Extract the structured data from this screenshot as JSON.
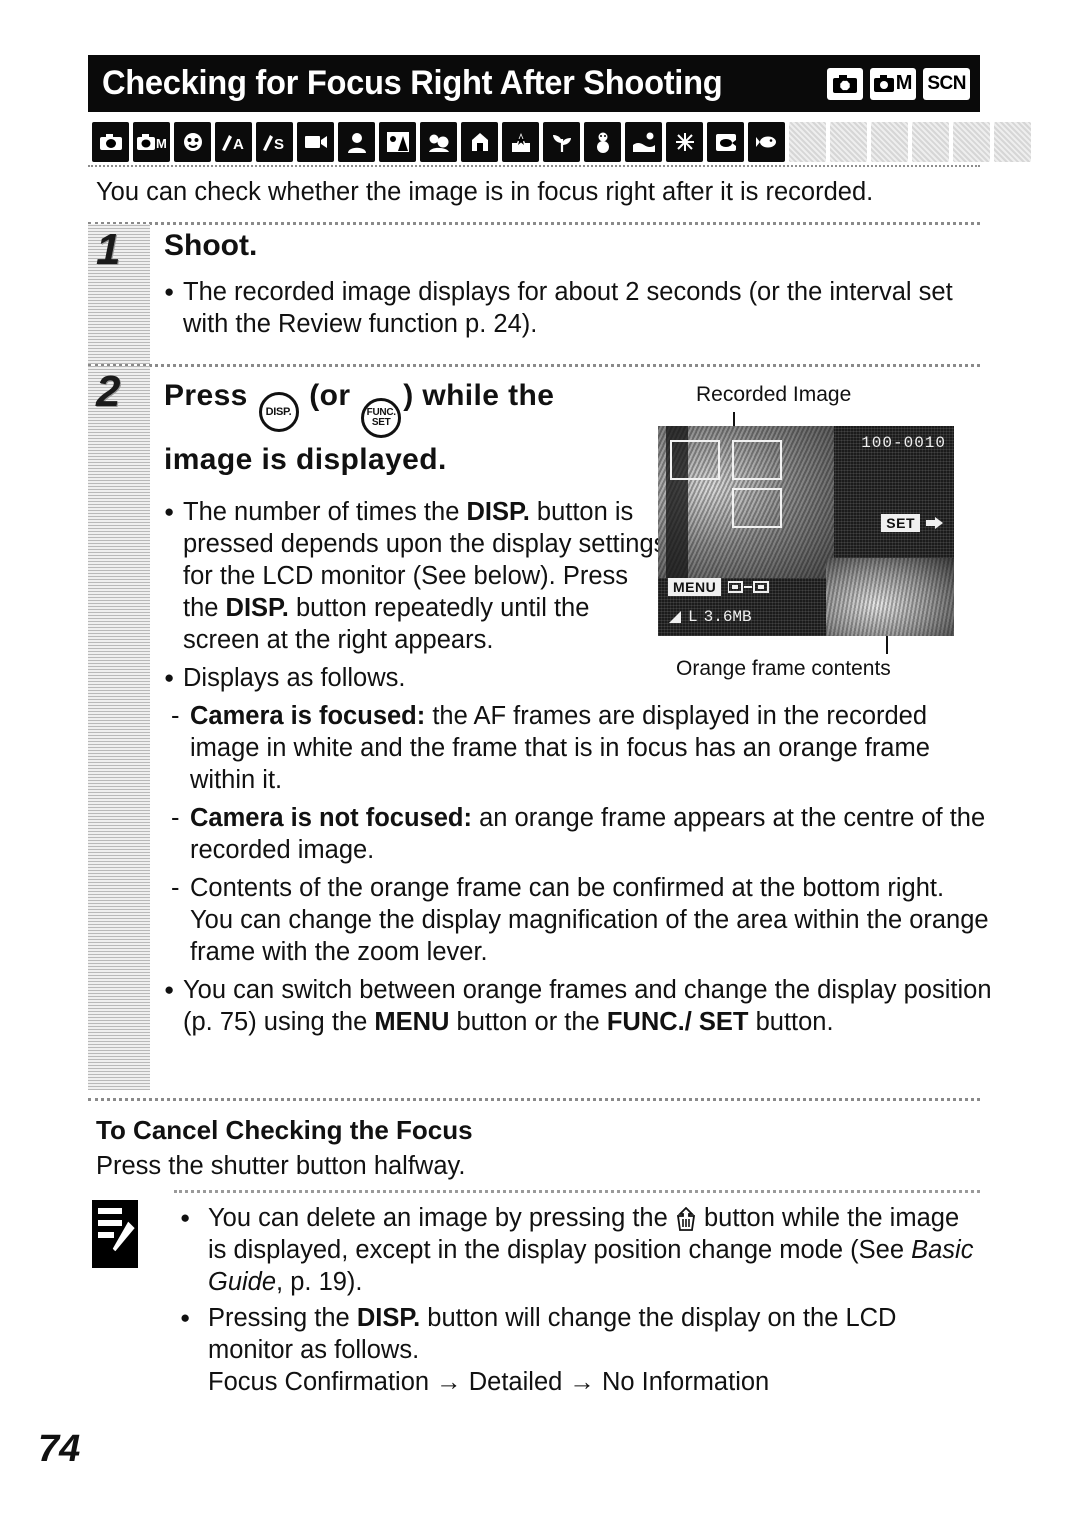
{
  "header": {
    "title": "Checking for Focus Right After Shooting",
    "mode_badges": [
      {
        "name": "auto-mode-badge",
        "label": ""
      },
      {
        "name": "manual-mode-badge",
        "label": "M"
      },
      {
        "name": "scene-mode-badge",
        "label": "SCN"
      }
    ]
  },
  "mode_icon_strip": [
    {
      "name": "auto-icon",
      "active": true
    },
    {
      "name": "camera-m-icon",
      "active": true
    },
    {
      "name": "digital-macro-icon",
      "active": true
    },
    {
      "name": "my-colors-a-icon",
      "active": true
    },
    {
      "name": "stitch-assist-s-icon",
      "active": true
    },
    {
      "name": "movie-icon",
      "active": true
    },
    {
      "name": "portrait-icon",
      "active": true
    },
    {
      "name": "night-snapshot-icon",
      "active": true
    },
    {
      "name": "kids-and-pets-icon",
      "active": true
    },
    {
      "name": "indoor-icon",
      "active": true
    },
    {
      "name": "foliage-icon",
      "active": true
    },
    {
      "name": "plant-icon",
      "active": true
    },
    {
      "name": "snow-icon",
      "active": true
    },
    {
      "name": "beach-icon",
      "active": true
    },
    {
      "name": "fireworks-icon",
      "active": true
    },
    {
      "name": "aquarium-icon",
      "active": true
    },
    {
      "name": "underwater-icon",
      "active": true
    },
    {
      "name": "disabled-mode-1-icon",
      "active": false
    },
    {
      "name": "disabled-mode-2-icon",
      "active": false
    },
    {
      "name": "disabled-mode-3-icon",
      "active": false
    },
    {
      "name": "disabled-mode-4-icon",
      "active": false
    },
    {
      "name": "disabled-mode-5-icon",
      "active": false
    },
    {
      "name": "disabled-mode-6-icon",
      "active": false
    }
  ],
  "intro": "You can check whether the image is in focus right after it is recorded.",
  "steps": [
    {
      "number": "1",
      "heading": "Shoot.",
      "bullets": [
        "The recorded image displays for about 2 seconds (or the interval set with the Review function p. 24)."
      ]
    },
    {
      "number": "2",
      "heading_part1": "Press",
      "heading_btn1": "DISP.",
      "heading_part2": "(or",
      "heading_btn2_line1": "FUNC.",
      "heading_btn2_line2": "SET",
      "heading_part3": ") while the",
      "heading_line2": "image is displayed.",
      "body_bullet_1_line1": "The number of times the ",
      "body_bullet_1_bold1": "DISP.",
      "body_bullet_1_line2": " button is pressed depends upon the display settings for the LCD monitor (See below). Press the ",
      "body_bullet_1_bold2": "DISP.",
      "body_bullet_1_line3": " button repeatedly until the screen at the right appears.",
      "body_bullet_2": "Displays as follows.",
      "dashes": [
        {
          "bold": "Camera is focused:",
          "text": " the AF frames are displayed in the recorded image in white and the frame that is in focus has an orange frame within it."
        },
        {
          "bold": "Camera is not focused:",
          "text": " an orange frame appears at the centre of the recorded image."
        },
        {
          "bold": "",
          "text": "Contents of the orange frame can be confirmed at the bottom right. You can change the display magnification of the area within the orange frame with the zoom lever."
        }
      ],
      "body_bullet_3_a": "You can switch between orange frames and change the display position (p. 75) using the ",
      "body_bullet_3_b": "MENU",
      "body_bullet_3_c": " button or the ",
      "body_bullet_3_d": "FUNC./ SET",
      "body_bullet_3_e": " button."
    }
  ],
  "figure": {
    "caption_top": "Recorded Image",
    "caption_bottom": "Orange frame contents",
    "lcd": {
      "file_number": "100-0010",
      "set_label": "SET",
      "menu_label": "MENU",
      "image_quality": "L",
      "file_size": "3.6MB"
    }
  },
  "cancel_section": {
    "heading": "To Cancel Checking the Focus",
    "text": "Press the shutter button halfway."
  },
  "note": {
    "icon": "note-pencil-icon",
    "bullets": [
      {
        "pre": "You can delete an image by pressing the ",
        "icon": "trash-delete-icon",
        "post_a": " button while the image is displayed, except in the display position change mode (See ",
        "italic": "Basic Guide",
        "post_b": ", p. 19)."
      },
      {
        "pre": "Pressing the ",
        "bold": "DISP.",
        "post": " button will change the display on the LCD monitor as follows."
      }
    ],
    "sequence": "Focus Confirmation → Detailed → No Information"
  },
  "page_number": "74"
}
